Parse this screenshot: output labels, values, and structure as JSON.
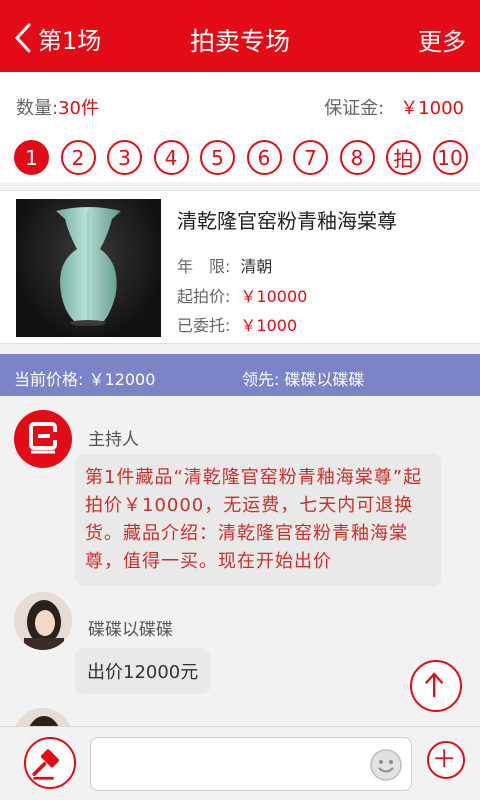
{
  "header": {
    "back_label": "第1场",
    "title": "拍卖专场",
    "more_label": "更多"
  },
  "info": {
    "quantity_label": "数量:",
    "quantity_value": "30件",
    "deposit_label": "保证金:",
    "deposit_value": "￥1000"
  },
  "lots": [
    "1",
    "2",
    "3",
    "4",
    "5",
    "6",
    "7",
    "8",
    "拍",
    "10"
  ],
  "product": {
    "name": "清乾隆官窑粉青釉海棠尊",
    "period_label": "年　限:",
    "period_value": "清朝",
    "start_label": "起拍价:",
    "start_value": "￥10000",
    "entrusted_label": "已委托:",
    "entrusted_value": "￥1000"
  },
  "pricebar": {
    "current_label": "当前价格:",
    "current_value": "￥12000",
    "leader_label": "领先:",
    "leader_value": "碟碟以碟碟"
  },
  "chat": {
    "host_name": "主持人",
    "host_message": "第1件藏品“清乾隆官窑粉青釉海棠尊”起拍价￥10000，无运费，七天内可退换货。藏品介绍：清乾隆官窑粉青釉海棠尊，值得一买。现在开始出价",
    "user_name": "碟碟以碟碟",
    "user_message": "出价12000元"
  },
  "colors": {
    "brand": "#e20b16",
    "pricebar": "#7b84c7"
  }
}
